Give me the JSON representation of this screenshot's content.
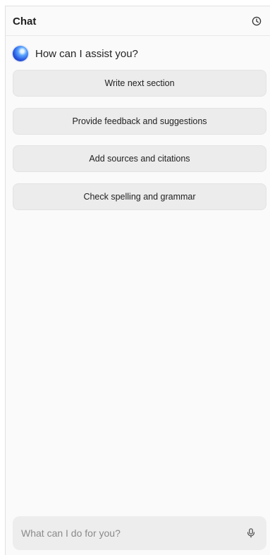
{
  "header": {
    "title": "Chat",
    "history_icon": "clock-icon"
  },
  "greeting": {
    "avatar_icon": "assistant-orb-icon",
    "text": "How can I assist you?"
  },
  "suggestions": [
    {
      "label": "Write next section"
    },
    {
      "label": "Provide feedback and suggestions"
    },
    {
      "label": "Add sources and citations"
    },
    {
      "label": "Check spelling and grammar"
    }
  ],
  "composer": {
    "placeholder": "What can I do for you?",
    "value": "",
    "mic_icon": "microphone-icon"
  },
  "colors": {
    "panel_background": "#fafafa",
    "button_background": "#ececec",
    "input_background": "#ededed",
    "assistant_orb": "#2756e0"
  }
}
